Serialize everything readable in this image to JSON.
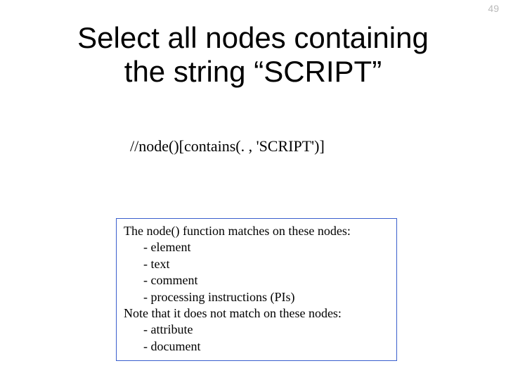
{
  "page_number": "49",
  "title_line1": "Select all nodes containing",
  "title_line2": "the string “SCRIPT”",
  "xpath_expression": "//node()[contains(. , 'SCRIPT')]",
  "info": {
    "matches_heading": "The node() function matches on these nodes:",
    "matches_items": [
      "- element",
      "- text",
      "- comment",
      "- processing instructions (PIs)"
    ],
    "nomatch_heading": "Note that it does not match on these nodes:",
    "nomatch_items": [
      "- attribute",
      "- document"
    ]
  }
}
